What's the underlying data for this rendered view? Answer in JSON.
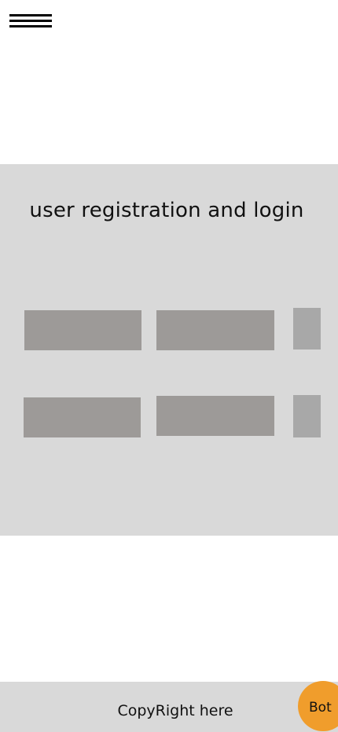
{
  "header": {
    "menu_icon": "hamburger-menu-icon"
  },
  "hero": {
    "title": "user registration and login",
    "tiles_row_1": 3,
    "tiles_row_2": 3
  },
  "footer": {
    "copyright": "CopyRight here"
  },
  "bot": {
    "label": "Bot"
  },
  "colors": {
    "background": "#ffffff",
    "section_gray": "#d9d9d9",
    "tile_gray": "#9d9a98",
    "bot_orange": "#f09d2c",
    "text": "#111111"
  }
}
